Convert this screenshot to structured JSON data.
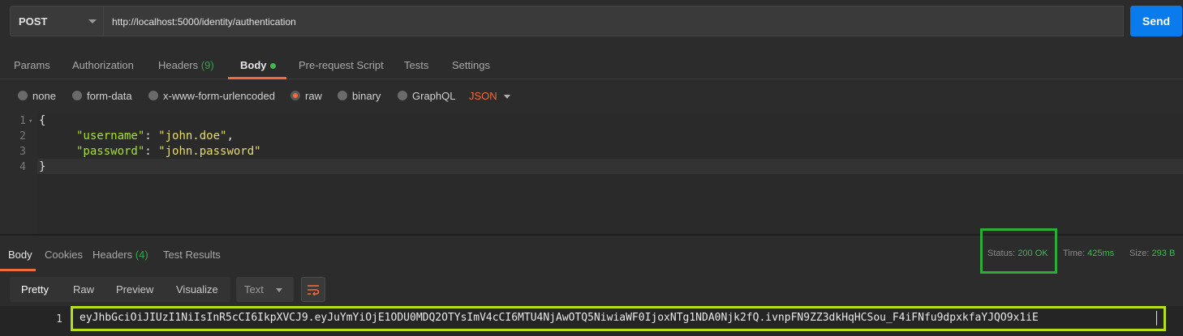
{
  "request": {
    "method": "POST",
    "url": "http://localhost:5000/identity/authentication",
    "send_label": "Send"
  },
  "request_tabs": {
    "params": "Params",
    "authorization": "Authorization",
    "headers": "Headers",
    "headers_count": "(9)",
    "body": "Body",
    "pre_request": "Pre-request Script",
    "tests": "Tests",
    "settings": "Settings"
  },
  "body_types": {
    "none": "none",
    "form_data": "form-data",
    "urlencoded": "x-www-form-urlencoded",
    "raw": "raw",
    "binary": "binary",
    "graphql": "GraphQL",
    "selected": "raw",
    "language": "JSON"
  },
  "editor": {
    "line_numbers": [
      "1",
      "2",
      "3",
      "4"
    ],
    "open_brace": "{",
    "close_brace": "}",
    "username_key": "\"username\"",
    "username_value": "\"john.doe\"",
    "password_key": "\"password\"",
    "password_value": "\"john.password\"",
    "colon": ": ",
    "comma": ","
  },
  "response_tabs": {
    "body": "Body",
    "cookies": "Cookies",
    "headers": "Headers",
    "headers_count": "(4)",
    "test_results": "Test Results"
  },
  "response_meta": {
    "status_label": "Status:",
    "status_value": "200 OK",
    "time_label": "Time:",
    "time_value": "425ms",
    "size_label": "Size:",
    "size_value": "293 B"
  },
  "view_modes": {
    "pretty": "Pretty",
    "raw": "Raw",
    "preview": "Preview",
    "visualize": "Visualize",
    "format": "Text"
  },
  "response_body": {
    "line_number": "1",
    "token": "eyJhbGciOiJIUzI1NiIsInR5cCI6IkpXVCJ9.eyJuYmYiOjE1ODU0MDQ2OTYsImV4cCI6MTU4NjAwOTQ5NiwiaWF0IjoxNTg1NDA0Njk2fQ.ivnpFN9ZZ3dkHqHCSou_F4iFNfu9dpxkfaYJQO9x1iE"
  },
  "colors": {
    "accent": "#f26b3a",
    "send": "#097bed",
    "status_highlight": "#2eac3a",
    "token_highlight": "#b4e01a"
  }
}
